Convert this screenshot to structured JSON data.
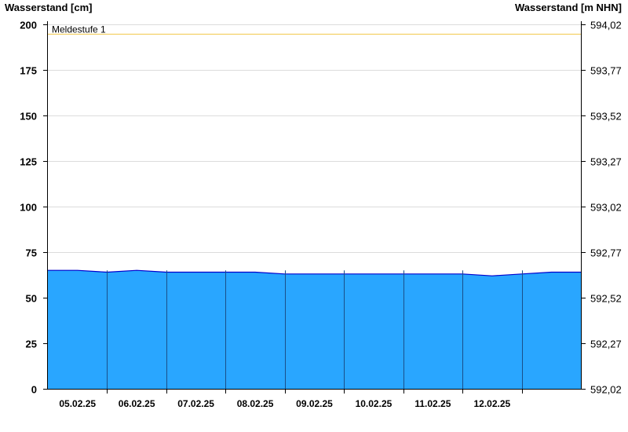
{
  "chart_data": {
    "type": "area",
    "ylabel": "Wasserstand [cm]",
    "ylabel_right": "Wasserstand [m NHN]",
    "ylim": [
      0,
      200
    ],
    "yticks": [
      0,
      25,
      50,
      75,
      100,
      125,
      150,
      175,
      200
    ],
    "yticks_right": [
      "592,02",
      "592,27",
      "592,52",
      "592,77",
      "593,02",
      "593,27",
      "593,52",
      "593,77",
      "594,02"
    ],
    "xlim": [
      "04.02.25 00:00",
      "13.02.25 00:00"
    ],
    "x_tick_labels": [
      "05.02.25",
      "06.02.25",
      "07.02.25",
      "08.02.25",
      "09.02.25",
      "10.02.25",
      "11.02.25",
      "12.02.25"
    ],
    "threshold": {
      "label": "Meldestufe 1",
      "value": 195,
      "color": "#f2c94c"
    },
    "series": [
      {
        "fill_color": "#29a6ff",
        "line_color": "#0000cc",
        "x": [
          "04.02.25 00:00",
          "04.02.25 12:00",
          "05.02.25 00:00",
          "05.02.25 12:00",
          "06.02.25 00:00",
          "06.02.25 12:00",
          "07.02.25 00:00",
          "07.02.25 12:00",
          "08.02.25 00:00",
          "08.02.25 12:00",
          "09.02.25 00:00",
          "09.02.25 12:00",
          "10.02.25 00:00",
          "10.02.25 12:00",
          "11.02.25 00:00",
          "11.02.25 12:00",
          "12.02.25 00:00",
          "12.02.25 12:00",
          "13.02.25 00:00"
        ],
        "values": [
          65,
          65,
          64,
          65,
          64,
          64,
          64,
          64,
          63,
          63,
          63,
          63,
          63,
          63,
          63,
          62,
          63,
          64,
          64
        ]
      }
    ],
    "grid": true
  }
}
